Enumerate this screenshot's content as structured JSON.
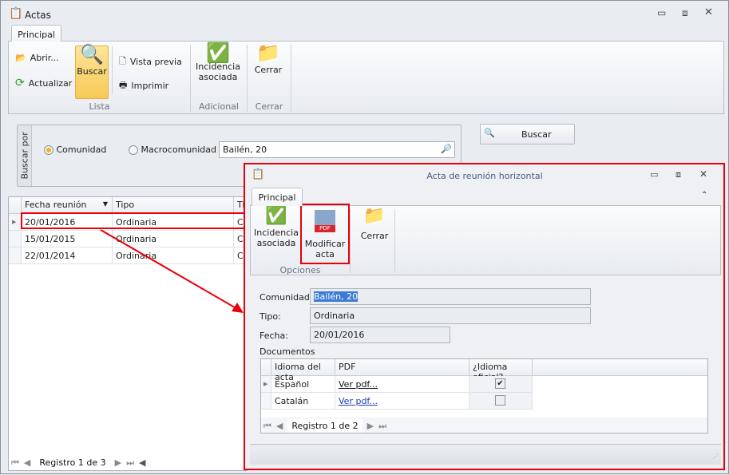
{
  "main_window": {
    "title": "Actas",
    "tab": "Principal",
    "ribbon": {
      "groups": [
        {
          "label": "Lista"
        },
        {
          "label": "Adicional"
        },
        {
          "label": "Cerrar"
        }
      ],
      "abrir": "Abrir...",
      "actualizar": "Actualizar",
      "buscar": "Buscar",
      "vista_previa": "Vista previa",
      "imprimir": "Imprimir",
      "incidencia": "Incidencia asociada",
      "cerrar": "Cerrar"
    }
  },
  "search": {
    "group_label": "Buscar por",
    "options": [
      {
        "label": "Comunidad",
        "selected": true
      },
      {
        "label": "Macrocomunidad",
        "selected": false
      }
    ],
    "value": "Bailén, 20",
    "button": "Buscar"
  },
  "grid": {
    "columns": [
      "Fecha reunión",
      "Tipo",
      "Ti"
    ],
    "rows": [
      [
        "20/01/2016",
        "Ordinaria",
        "Co"
      ],
      [
        "15/01/2015",
        "Ordinaria",
        "Co"
      ],
      [
        "22/01/2014",
        "Ordinaria",
        "Co"
      ]
    ],
    "nav": "Registro 1 de 3"
  },
  "dialog": {
    "title": "Acta de reunión horizontal",
    "tab": "Principal",
    "group": "Opciones",
    "incidencia": "Incidencia asociada",
    "modificar": "Modificar acta",
    "cerrar": "Cerrar",
    "form": {
      "comunidad_label": "Comunidad",
      "comunidad": "Bailén, 20",
      "tipo_label": "Tipo:",
      "tipo": "Ordinaria",
      "fecha_label": "Fecha:",
      "fecha": "20/01/2016",
      "documentos_label": "Documentos"
    },
    "docs": {
      "columns": [
        "Idioma del acta",
        "PDF",
        "¿Idioma oficial?"
      ],
      "rows": [
        {
          "idioma": "Español",
          "pdf": "Ver pdf...",
          "oficial": true
        },
        {
          "idioma": "Catalán",
          "pdf": "Ver pdf...",
          "oficial": false
        }
      ],
      "nav": "Registro 1 de 2"
    }
  },
  "colors": {
    "highlight": "#e8000b",
    "accent": "#f7d36b",
    "link": "#1a3fb5"
  }
}
